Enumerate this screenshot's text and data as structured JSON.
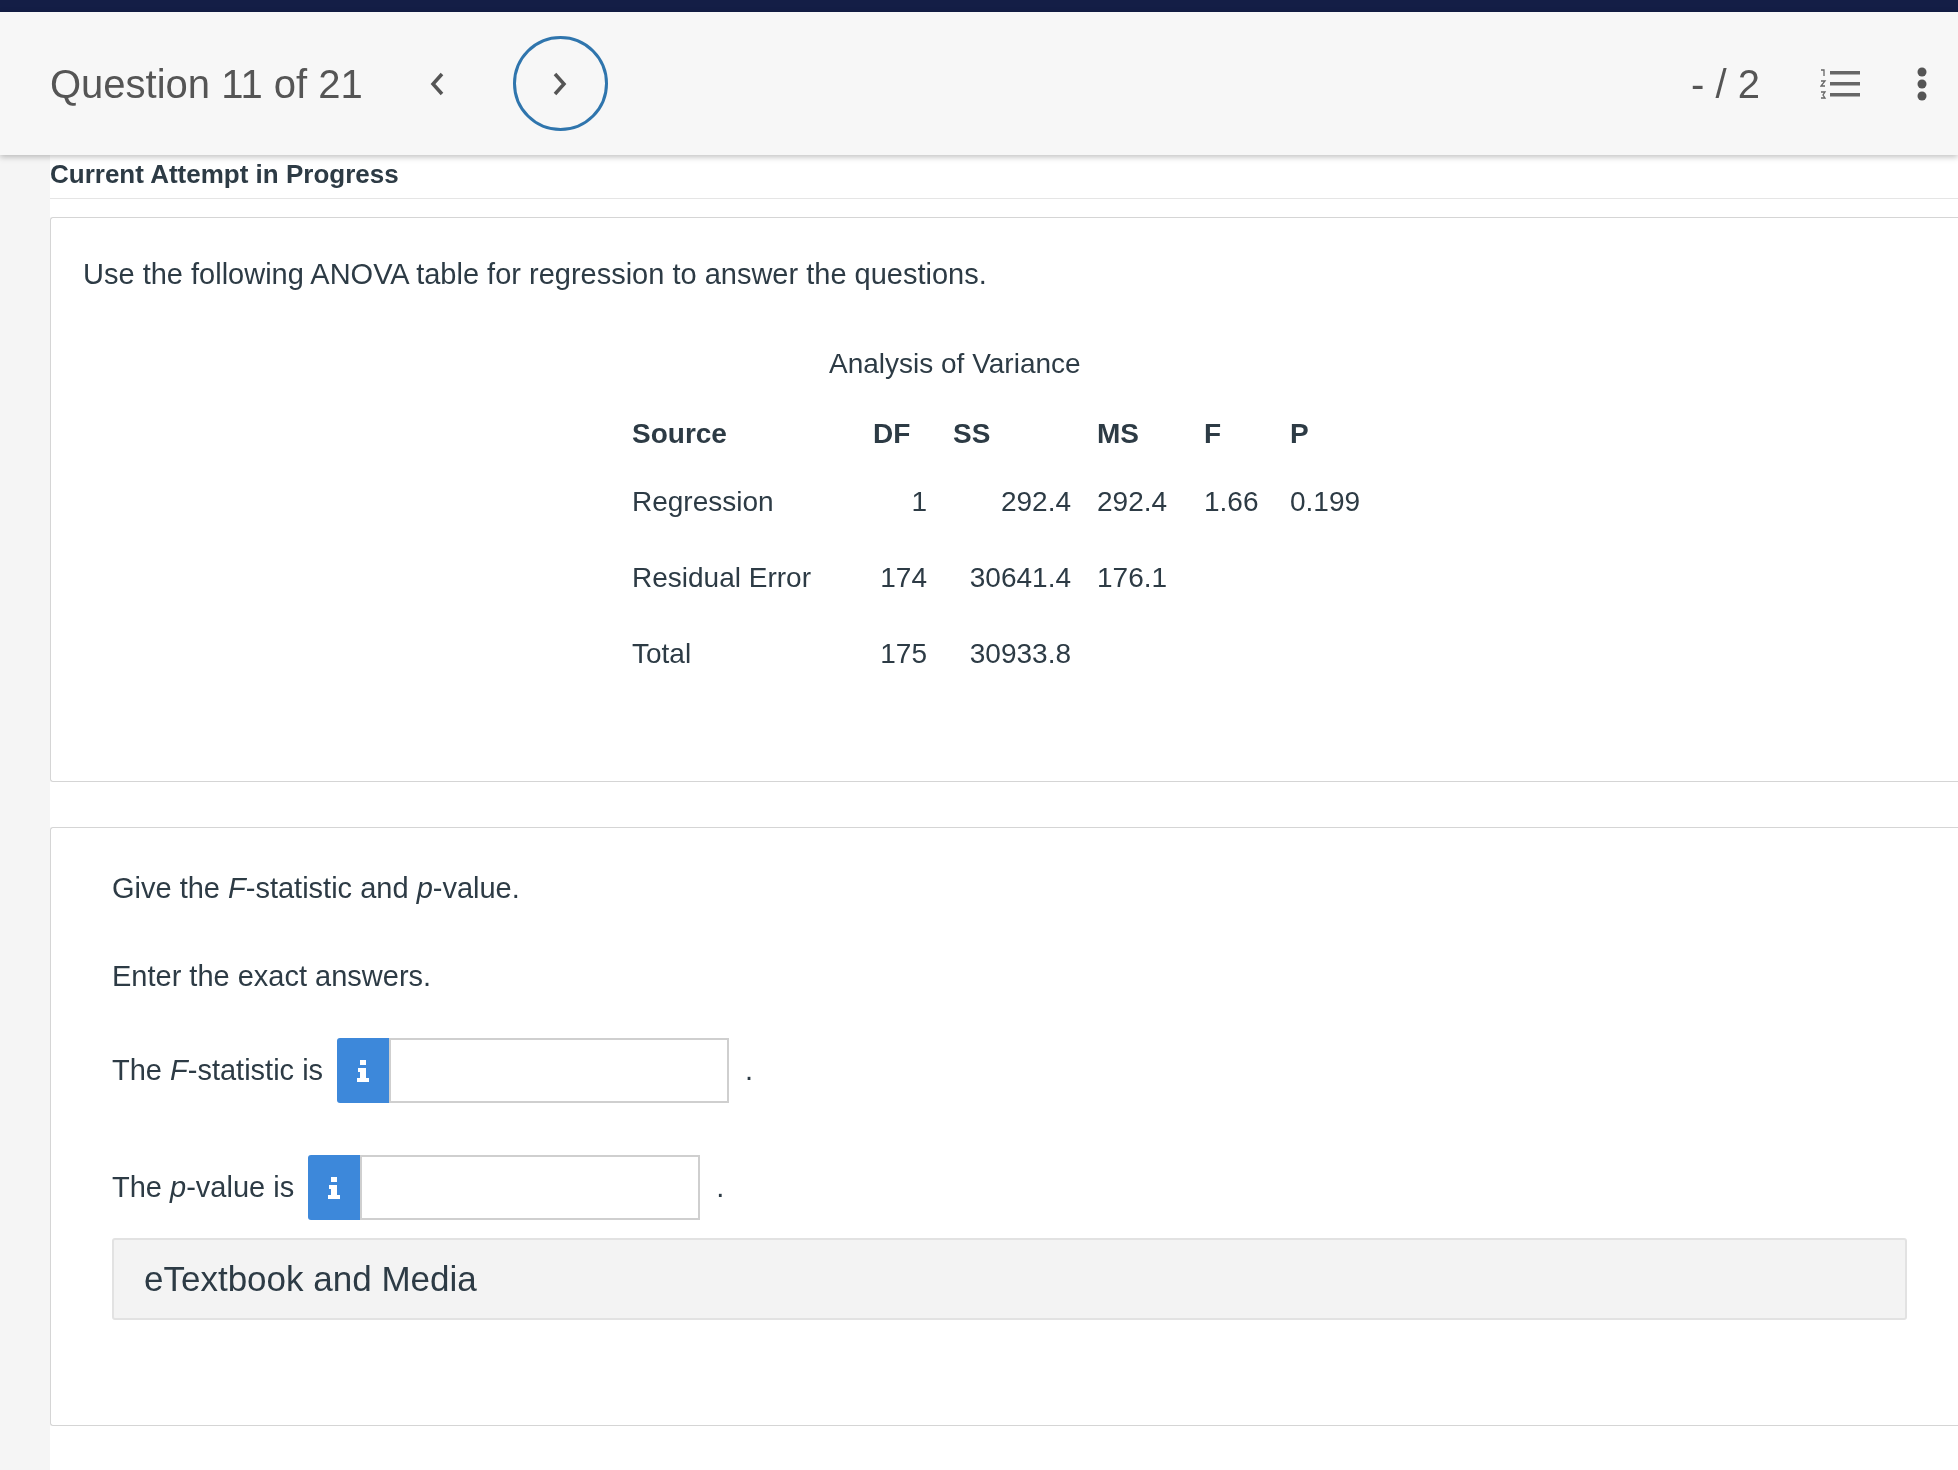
{
  "header": {
    "title": "Question 11 of 21",
    "score": "- / 2"
  },
  "attempt_heading": "Current Attempt in Progress",
  "intro": "Use the following ANOVA table for regression to answer the questions.",
  "table": {
    "title": "Analysis of Variance",
    "columns": [
      "Source",
      "DF",
      "SS",
      "MS",
      "F",
      "P"
    ],
    "rows": [
      [
        "Regression",
        "1",
        "292.4",
        "292.4",
        "1.66",
        "0.199"
      ],
      [
        "Residual Error",
        "174",
        "30641.4",
        "176.1",
        "",
        ""
      ],
      [
        "Total",
        "175",
        "30933.8",
        "",
        "",
        ""
      ]
    ]
  },
  "question": {
    "prompt": "Give the *F*-statistic and *p*-value.",
    "instruction": "Enter the exact answers.",
    "answers": [
      {
        "label": "The *F*-statistic is",
        "suffix": "."
      },
      {
        "label": "The *p*-value is",
        "suffix": "."
      }
    ],
    "resources": "eTextbook and Media"
  }
}
